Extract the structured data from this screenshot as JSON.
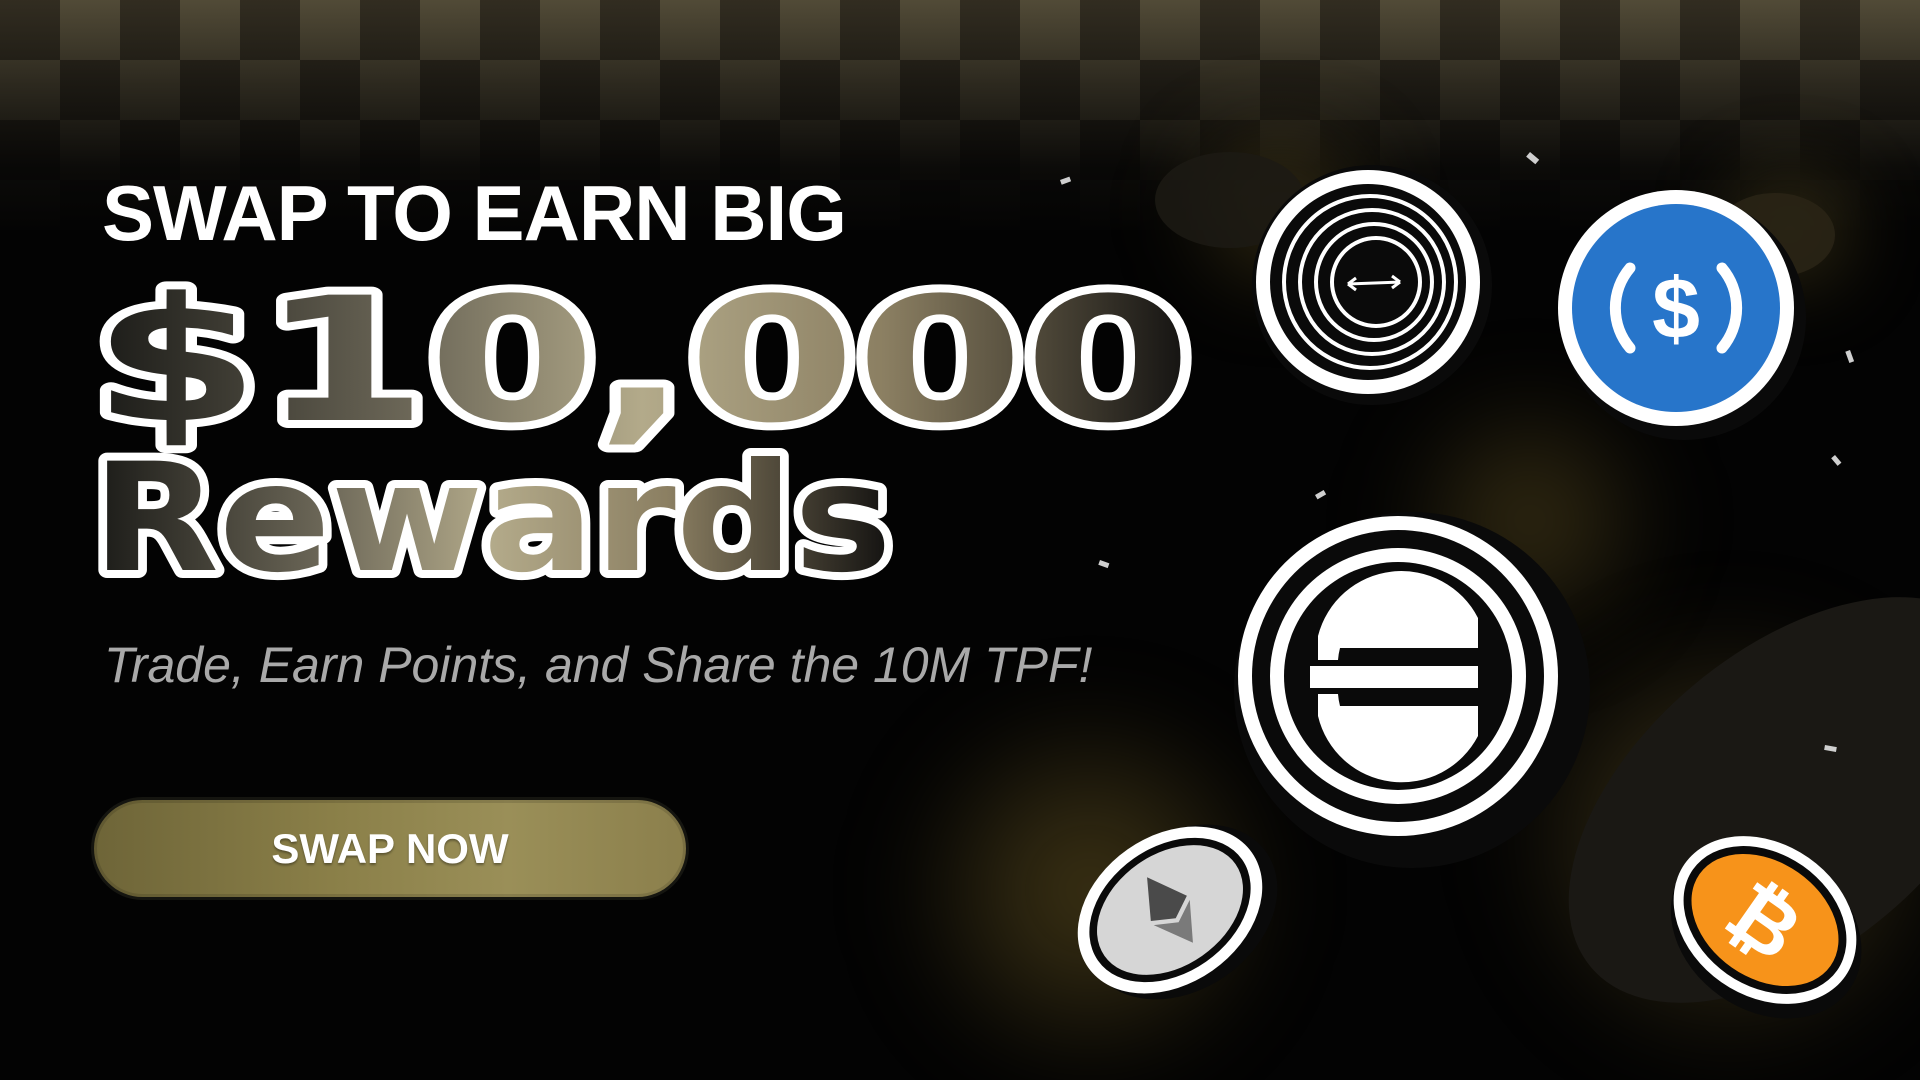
{
  "headline": "SWAP TO EARN BIG",
  "amount": "$10,000",
  "rewards": "Rewards",
  "subtitle": "Trade, Earn Points, and Share the 10M TPF!",
  "cta_label": "SWAP NOW",
  "colors": {
    "background": "#030303",
    "accent_gold": "#a9a083",
    "button": "#8a7f48",
    "usdc_blue": "#2775ca",
    "bitcoin_orange": "#f7931a"
  },
  "icons": [
    "worldcoin-icon",
    "usdc-icon",
    "solana-icon",
    "ethereum-icon",
    "bitcoin-icon"
  ],
  "usdc_glyph": "$"
}
